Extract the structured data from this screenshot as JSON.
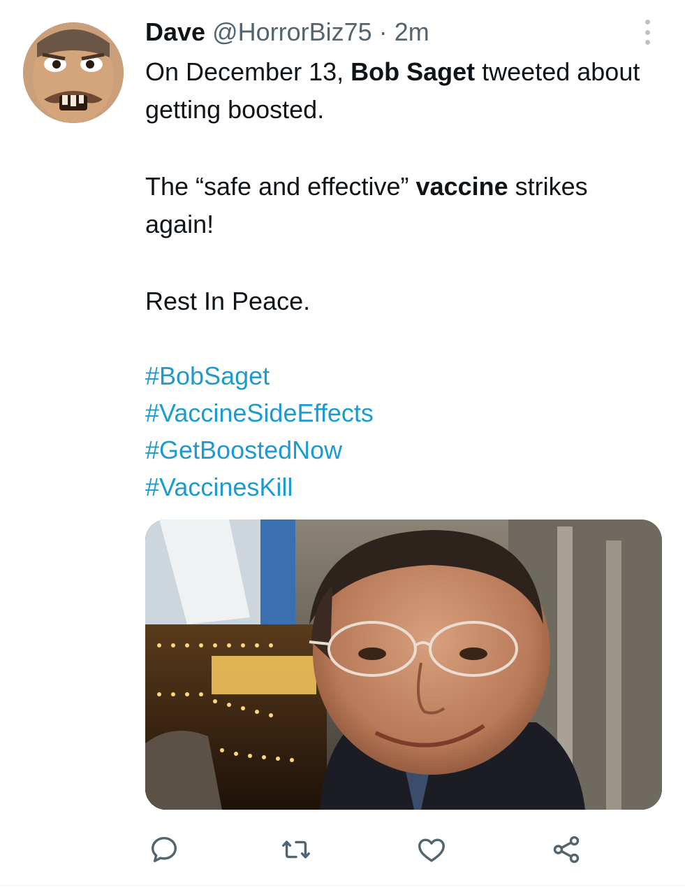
{
  "tweet": {
    "author_name": "Dave",
    "author_handle": "@HorrorBiz75",
    "separator": "·",
    "time": "2m",
    "text_before_bold_1": "On December 13, ",
    "bold_1": "Bob Saget",
    "text_after_bold_1": " tweeted about getting boosted.",
    "text_before_bold_2": "The “safe and effective” ",
    "bold_2": "vaccine",
    "text_after_bold_2": " strikes again!",
    "line_3": "Rest In Peace.",
    "hashtags": [
      "#BobSaget",
      "#VaccineSideEffects",
      "#GetBoostedNow",
      "#VaccinesKill"
    ]
  },
  "icons": {
    "more": "more-vertical-icon",
    "reply": "reply-icon",
    "retweet": "retweet-icon",
    "like": "heart-icon",
    "share": "share-icon"
  },
  "colors": {
    "text": "#0f1419",
    "secondary": "#536471",
    "link": "#1d9bd0",
    "icon": "#536471"
  }
}
